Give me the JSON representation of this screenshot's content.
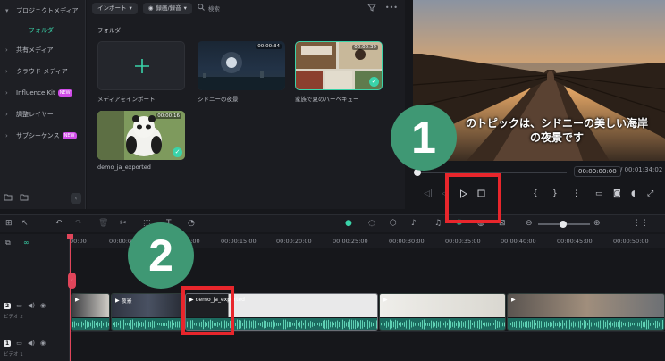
{
  "sidebar": {
    "items": [
      {
        "label": "プロジェクトメディア",
        "chev": "▾"
      },
      {
        "label": "フォルダ"
      },
      {
        "label": "共有メディア",
        "chev": "›"
      },
      {
        "label": "クラウド メディア",
        "chev": "›"
      },
      {
        "label": "Influence Kit",
        "chev": "›",
        "badge": "NEW"
      },
      {
        "label": "調整レイヤー",
        "chev": "›"
      },
      {
        "label": "サブシーケンス",
        "chev": "›",
        "badge": "NEW"
      }
    ]
  },
  "media": {
    "import_label": "インポート",
    "record_label": "録画/録音",
    "search_placeholder": "検索",
    "folder_label": "フォルダ",
    "import_card_label": "メディアをインポート",
    "items": [
      {
        "name": "シドニーの夜景",
        "duration": "00:00:34"
      },
      {
        "name": "家族で夏のバーベキュー",
        "duration": "00:00:39"
      },
      {
        "name": "demo_ja_exported",
        "duration": "00:00:16"
      }
    ]
  },
  "preview": {
    "subtitle_line1": "のトピックは、シドニーの美しい海岸",
    "subtitle_line2": "の夜景です",
    "current_time": "00:00:00:00",
    "total_time": "/ 00:01:34:02"
  },
  "timeline": {
    "ruler_labels": [
      "00:00",
      "00:00:05:00",
      "00:00:10:00",
      "00:00:15:00",
      "00:00:20:00",
      "00:00:25:00",
      "00:00:30:00",
      "00:00:35:00",
      "00:00:40:00",
      "00:00:45:00",
      "00:00:50:00"
    ],
    "tracks": [
      {
        "number": "2",
        "label": "ビデオ 2"
      },
      {
        "number": "1",
        "label": "ビデオ 1"
      }
    ],
    "clips": [
      {
        "name": ""
      },
      {
        "name": "夜景"
      },
      {
        "name": "demo_ja_exported"
      },
      {
        "name": ""
      },
      {
        "name": ""
      }
    ]
  },
  "overlays": {
    "marker1": "1",
    "marker2": "2"
  },
  "colors": {
    "accent": "#3ad3a9",
    "marker": "#3f9874",
    "highlight": "#e8262c",
    "playhead": "#e0455a"
  }
}
